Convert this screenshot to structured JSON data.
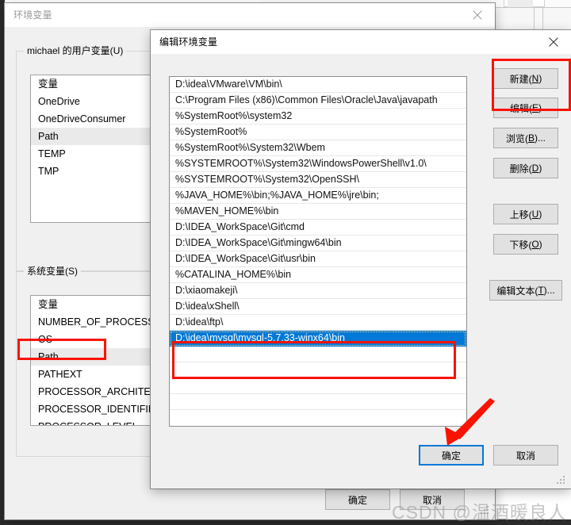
{
  "background_window": {
    "description": "partially visible application window behind the dialogs"
  },
  "env_window": {
    "title": "环境变量",
    "close_icon": "close-icon",
    "user_group": {
      "label": "michael 的用户变量(U)",
      "column_header": "变量",
      "items": [
        {
          "name": "OneDrive",
          "selected": false
        },
        {
          "name": "OneDriveConsumer",
          "selected": false
        },
        {
          "name": "Path",
          "selected": true
        },
        {
          "name": "TEMP",
          "selected": false
        },
        {
          "name": "TMP",
          "selected": false
        }
      ]
    },
    "system_group": {
      "label": "系统变量(S)",
      "column_header": "变量",
      "items": [
        {
          "name": "NUMBER_OF_PROCESSORS",
          "selected": false
        },
        {
          "name": "OS",
          "selected": false
        },
        {
          "name": "Path",
          "selected": false,
          "annotated": true
        },
        {
          "name": "PATHEXT",
          "selected": false
        },
        {
          "name": "PROCESSOR_ARCHITECT...",
          "selected": false
        },
        {
          "name": "PROCESSOR_IDENTIFIER",
          "selected": false
        },
        {
          "name": "PROCESSOR_LEVEL",
          "selected": false
        }
      ]
    },
    "buttons": {
      "ok": "确定",
      "cancel": "取消"
    }
  },
  "edit_dialog": {
    "title": "编辑环境变量",
    "close_icon": "close-icon",
    "paths": [
      "D:\\idea\\VMware\\VM\\bin\\",
      "C:\\Program Files (x86)\\Common Files\\Oracle\\Java\\javapath",
      "%SystemRoot%\\system32",
      "%SystemRoot%",
      "%SystemRoot%\\System32\\Wbem",
      "%SYSTEMROOT%\\System32\\WindowsPowerShell\\v1.0\\",
      "%SYSTEMROOT%\\System32\\OpenSSH\\",
      "%JAVA_HOME%\\bin;%JAVA_HOME%\\jre\\bin;",
      "%MAVEN_HOME%\\bin",
      "D:\\IDEA_WorkSpace\\Git\\cmd",
      "D:\\IDEA_WorkSpace\\Git\\mingw64\\bin",
      "D:\\IDEA_WorkSpace\\Git\\usr\\bin",
      "%CATALINA_HOME%\\bin",
      "D:\\xiaomakeji\\",
      "D:\\idea\\xShell\\",
      "D:\\idea\\ftp\\",
      "D:\\idea\\mysql\\mysql-5.7.33-winx64\\bin",
      "",
      "",
      "",
      ""
    ],
    "selected_index": 16,
    "side_buttons": [
      {
        "id": "new",
        "label": "新建(N)",
        "accel": "N",
        "annotated": true
      },
      {
        "id": "edit",
        "label": "编辑(E)",
        "accel": "E",
        "annotated": false
      },
      {
        "id": "browse",
        "label": "浏览(B)...",
        "accel": "B",
        "annotated": false
      },
      {
        "id": "delete",
        "label": "删除(D)",
        "accel": "D",
        "annotated": false
      },
      {
        "id": "move-up",
        "label": "上移(U)",
        "accel": "U",
        "annotated": false
      },
      {
        "id": "move-down",
        "label": "下移(O)",
        "accel": "O",
        "annotated": false
      },
      {
        "id": "edit-text",
        "label": "编辑文本(T)...",
        "accel": "T",
        "annotated": false
      }
    ],
    "buttons": {
      "ok": "确定",
      "cancel": "取消"
    }
  },
  "annotations": {
    "accent_color": "#fb1200",
    "selection_color": "#0078d7",
    "arrow_target": "确定"
  },
  "watermark": {
    "text": "CSDN @温酒暖良人"
  }
}
